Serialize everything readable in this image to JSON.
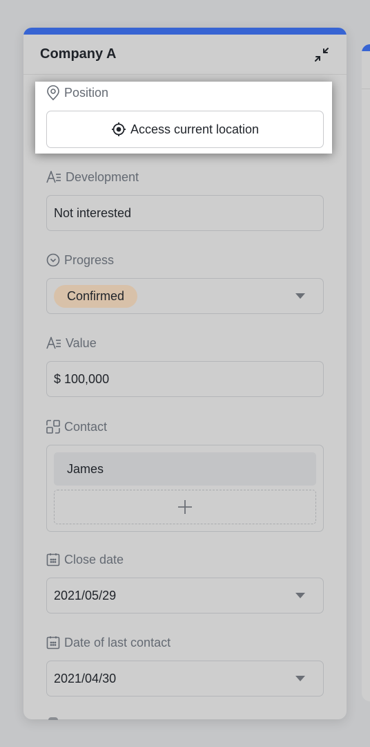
{
  "card": {
    "title": "Company A",
    "accent_color": "#3764d3",
    "collapse_icon": "collapse-arrows-icon"
  },
  "position": {
    "label": "Position",
    "icon": "location-pin-icon",
    "button_label": "Access current location",
    "button_icon": "crosshair-target-icon"
  },
  "fields": {
    "development": {
      "label": "Development",
      "icon": "text-field-icon",
      "value": "Not interested"
    },
    "progress": {
      "label": "Progress",
      "icon": "single-select-icon",
      "value": "Confirmed",
      "tag_color": "#d8c1a9"
    },
    "value": {
      "label": "Value",
      "icon": "text-field-icon",
      "value": "$ 100,000"
    },
    "contact": {
      "label": "Contact",
      "icon": "link-record-icon",
      "items": [
        "James"
      ],
      "add_icon": "plus-icon"
    },
    "close_date": {
      "label": "Close date",
      "icon": "calendar-icon",
      "value": "2021/05/29"
    },
    "last_contact": {
      "label": "Date of last contact",
      "icon": "calendar-icon",
      "value": "2021/04/30"
    }
  }
}
